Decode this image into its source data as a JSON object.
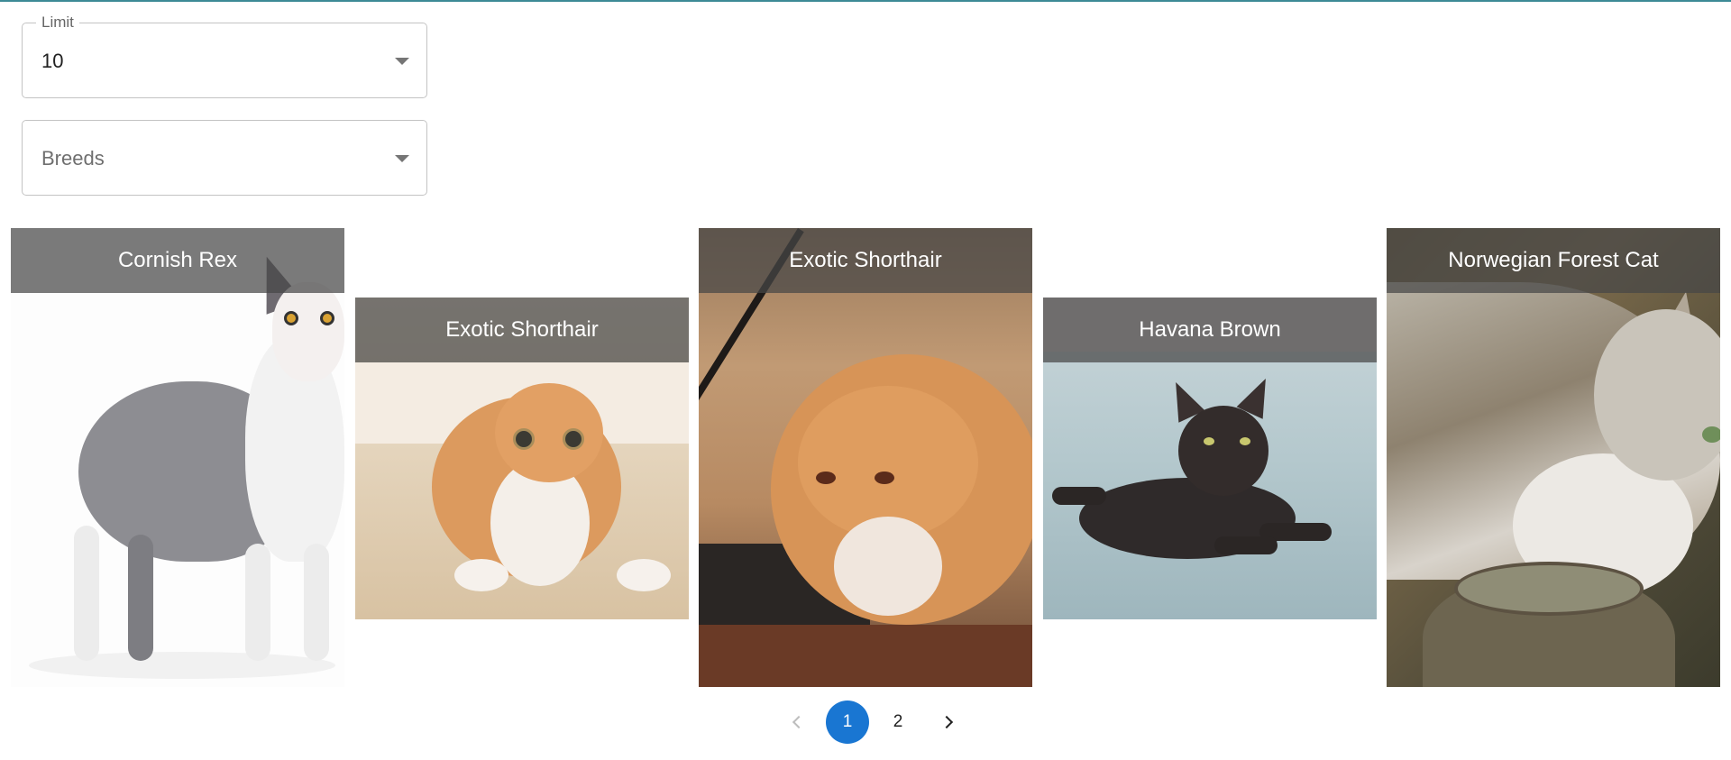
{
  "filters": {
    "limit": {
      "label": "Limit",
      "value": "10"
    },
    "breeds": {
      "placeholder": "Breeds"
    }
  },
  "cards": [
    {
      "breed": "Cornish Rex"
    },
    {
      "breed": "Exotic Shorthair"
    },
    {
      "breed": "Exotic Shorthair"
    },
    {
      "breed": "Havana Brown"
    },
    {
      "breed": "Norwegian Forest Cat"
    }
  ],
  "pagination": {
    "pages": [
      "1",
      "2"
    ],
    "current": "1"
  },
  "colors": {
    "accent": "#1976d2",
    "caption_bg": "rgba(70,70,70,0.72)",
    "top_border": "#3d8a96"
  },
  "icons": {
    "select_arrow": "arrow-drop-down-icon",
    "prev": "chevron-left-icon",
    "next": "chevron-right-icon"
  }
}
